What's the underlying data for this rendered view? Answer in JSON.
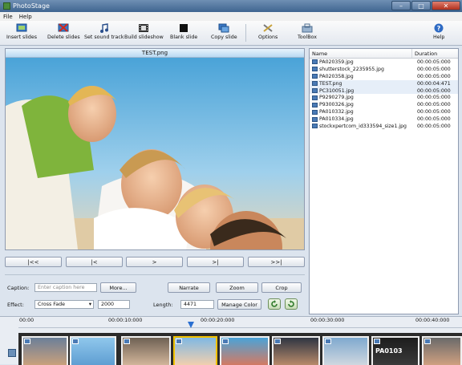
{
  "window": {
    "title": "PhotoStage"
  },
  "menu": [
    "File",
    "Help"
  ],
  "toolbar": [
    {
      "label": "Insert slides",
      "icon": "insert-slides-icon"
    },
    {
      "label": "Delete slides",
      "icon": "delete-slides-icon"
    },
    {
      "label": "Set sound track",
      "icon": "music-note-icon"
    },
    {
      "label": "Build slideshow",
      "icon": "film-icon"
    },
    {
      "label": "Blank slide",
      "icon": "blank-slide-icon"
    },
    {
      "label": "Copy slide",
      "icon": "copy-slide-icon"
    },
    {
      "label": "Options",
      "icon": "options-icon"
    },
    {
      "label": "ToolBox",
      "icon": "toolbox-icon"
    },
    {
      "label": "Help",
      "icon": "help-icon"
    }
  ],
  "preview": {
    "title": "TEST.png"
  },
  "nav": [
    "|<<",
    "|<",
    ">",
    ">|",
    ">>|"
  ],
  "controls": {
    "caption_label": "Caption:",
    "caption_placeholder": "Enter caption here",
    "more_button": "More...",
    "narrate_button": "Narrate",
    "zoom_button": "Zoom",
    "crop_button": "Crop",
    "effect_label": "Effect:",
    "effect_value": "Cross Fade",
    "effect_duration": "2000",
    "length_label": "Length:",
    "length_value": "4471",
    "manage_color_button": "Manage Color"
  },
  "list": {
    "col_name": "Name",
    "col_duration": "Duration",
    "items": [
      {
        "name": "PA020359.jpg",
        "duration": "00:00:05:000"
      },
      {
        "name": "shutterstock_2235955.jpg",
        "duration": "00:00:05:000"
      },
      {
        "name": "PA020358.jpg",
        "duration": "00:00:05:000"
      },
      {
        "name": "TEST.png",
        "duration": "00:00:04:471"
      },
      {
        "name": "PC310051.jpg",
        "duration": "00:00:05:000"
      },
      {
        "name": "P9290279.jpg",
        "duration": "00:00:05:000"
      },
      {
        "name": "P9300326.jpg",
        "duration": "00:00:05:000"
      },
      {
        "name": "PA010332.jpg",
        "duration": "00:00:05:000"
      },
      {
        "name": "PA010334.jpg",
        "duration": "00:00:05:000"
      },
      {
        "name": "stockxpertcom_id333594_size1.jpg",
        "duration": "00:00:05:000"
      }
    ]
  },
  "timeline": {
    "ticks": [
      "00:00",
      "00:00:10:000",
      "00:00:20:000",
      "00:00:30:000",
      "00:00:40:000"
    ],
    "frame_code": "PA0103"
  }
}
